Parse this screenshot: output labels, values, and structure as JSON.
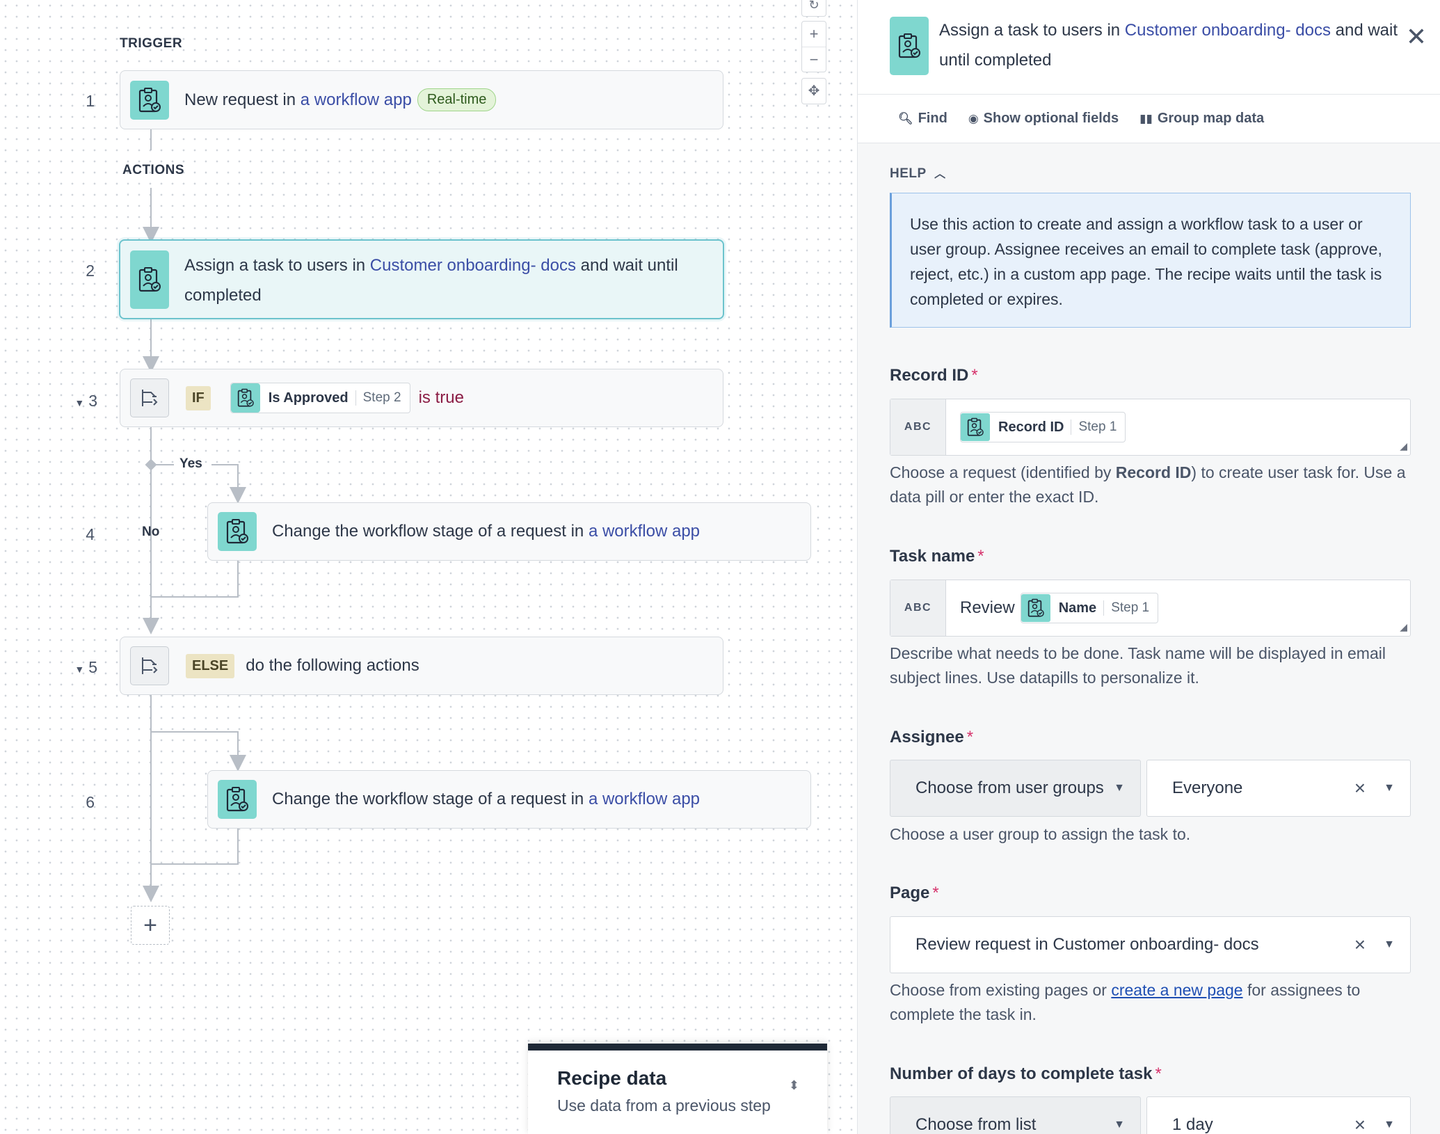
{
  "canvas": {
    "trigger_label": "TRIGGER",
    "actions_label": "ACTIONS",
    "steps": [
      {
        "num": "1",
        "prefix": "New request in ",
        "link": "a workflow app",
        "badge": "Real-time"
      },
      {
        "num": "2",
        "prefix": "Assign a task to users in ",
        "link": "Customer onboarding- docs",
        "suffix": " and wait until",
        "line2": "completed"
      },
      {
        "num": "3",
        "tag": "IF",
        "pill_name": "Is Approved",
        "pill_step": "Step 2",
        "condition": "is true"
      },
      {
        "num": "4",
        "prefix": "Change the workflow stage of a request in ",
        "link": "a workflow app"
      },
      {
        "num": "5",
        "tag": "ELSE",
        "text": "do the following actions"
      },
      {
        "num": "6",
        "prefix": "Change the workflow stage of a request in ",
        "link": "a workflow app"
      }
    ],
    "branch_yes": "Yes",
    "branch_no": "No",
    "add_symbol": "+",
    "zoom": {
      "reset": "↻",
      "plus": "+",
      "minus": "−",
      "fit": "✥"
    },
    "recipe_data": {
      "title": "Recipe data",
      "subtitle": "Use data from a previous step",
      "toggle": "⬍"
    }
  },
  "panel": {
    "title_prefix": "Assign a task to users in ",
    "title_link": "Customer onboarding- docs",
    "title_suffix": " and wait until completed",
    "close": "✕",
    "toolbar": {
      "find": "Find",
      "optional": "Show optional fields",
      "group": "Group map data"
    },
    "help_label": "HELP",
    "help_text": "Use this action to create and assign a workflow task to a user or user group. Assignee receives an email to complete task (approve, reject, etc.) in a custom app page. The recipe waits until the task is completed or expires.",
    "fields": {
      "record_id": {
        "label": "Record ID",
        "abc": "ABC",
        "pill_name": "Record ID",
        "pill_step": "Step 1",
        "hint_a": "Choose a request (identified by ",
        "hint_b": "Record ID",
        "hint_c": ") to create user task for. Use a data pill or enter the exact ID."
      },
      "task_name": {
        "label": "Task name",
        "abc": "ABC",
        "value": "Review",
        "pill_name": "Name",
        "pill_step": "Step 1",
        "hint": "Describe what needs to be done. Task name will be displayed in email subject lines. Use datapills to personalize it."
      },
      "assignee": {
        "label": "Assignee",
        "mode": "Choose from user groups",
        "value": "Everyone",
        "hint": "Choose a user group to assign the task to."
      },
      "page": {
        "label": "Page",
        "value": "Review request in Customer onboarding- docs",
        "hint_a": "Choose from existing pages or ",
        "hint_link": "create a new page",
        "hint_b": " for assignees to complete the task in."
      },
      "days": {
        "label": "Number of days to complete task",
        "mode": "Choose from list",
        "value": "1 day"
      }
    },
    "required_mark": "*"
  },
  "colors": {
    "accent_teal": "#7fd7cf",
    "selected_border": "#6cc3cd",
    "link": "#3b4ea6",
    "required": "#d6336c",
    "help_bg": "#e8f1fb"
  }
}
